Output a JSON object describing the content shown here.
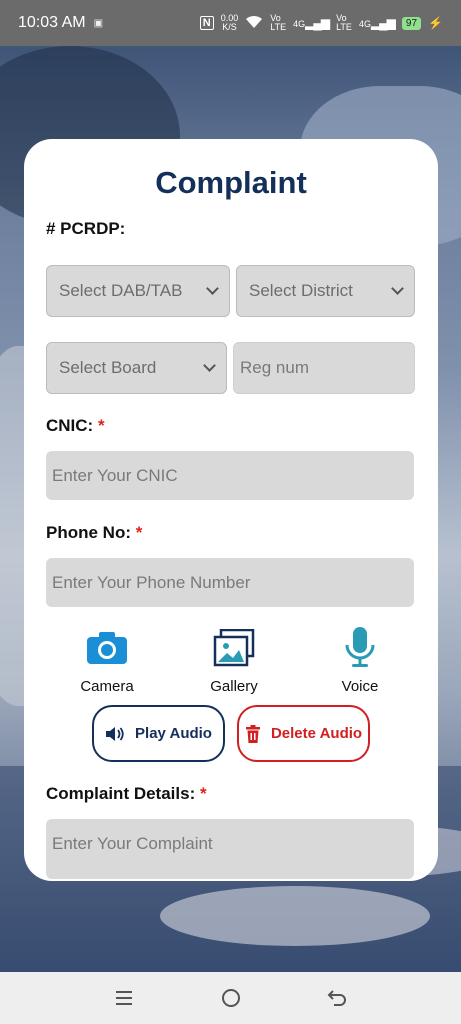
{
  "status_bar": {
    "time": "10:03 AM",
    "speed_top": "0.00",
    "speed_bottom": "K/S",
    "volte1": "Vo\nLTE",
    "net1": "4G",
    "volte2": "Vo\nLTE",
    "net2": "4G",
    "battery": "97"
  },
  "form": {
    "title": "Complaint",
    "pcrdp_label": "# PCRDP:",
    "dab_select": "Select DAB/TAB",
    "district_select": "Select District",
    "board_select": "Select Board",
    "reg_placeholder": "Reg num",
    "cnic_label": "CNIC:",
    "cnic_placeholder": "Enter Your CNIC",
    "phone_label": "Phone No:",
    "phone_placeholder": "Enter Your Phone Number",
    "required_mark": "*",
    "camera_label": "Camera",
    "gallery_label": "Gallery",
    "voice_label": "Voice",
    "play_audio": "Play Audio",
    "delete_audio": "Delete Audio",
    "details_label": "Complaint Details:",
    "details_placeholder": "Enter Your Complaint"
  },
  "colors": {
    "title": "#14305a",
    "accent_blue": "#1a8fd6",
    "teal": "#2a9bb5",
    "danger": "#d02020"
  },
  "icons": {
    "camera": "camera-icon",
    "gallery": "gallery-icon",
    "voice": "microphone-icon",
    "play": "speaker-icon",
    "delete": "trash-icon"
  }
}
